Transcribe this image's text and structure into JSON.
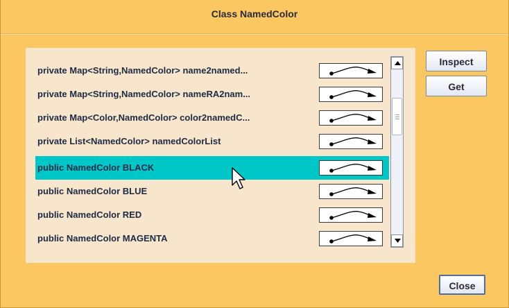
{
  "dialog": {
    "title": "Class NamedColor"
  },
  "fields": [
    {
      "label": "private Map<String,NamedColor> name2named..."
    },
    {
      "label": "private Map<String,NamedColor> nameRA2nam..."
    },
    {
      "label": "private Map<Color,NamedColor> color2namedC..."
    },
    {
      "label": "private List<NamedColor> namedColorList"
    },
    {
      "label": "public NamedColor BLACK",
      "selected": true
    },
    {
      "label": "public NamedColor BLUE"
    },
    {
      "label": "public NamedColor RED"
    },
    {
      "label": "public NamedColor MAGENTA"
    }
  ],
  "buttons": {
    "inspect": "Inspect",
    "get": "Get",
    "close": "Close"
  },
  "icons": {
    "reference": "object-reference-arrow-icon",
    "scroll_up": "triangle-up-icon",
    "scroll_down": "triangle-down-icon",
    "pointer": "mouse-pointer-icon"
  },
  "colors": {
    "window_bg": "#fbc761",
    "panel_bg": "#f7e5cc",
    "selection": "#00c7c7"
  }
}
